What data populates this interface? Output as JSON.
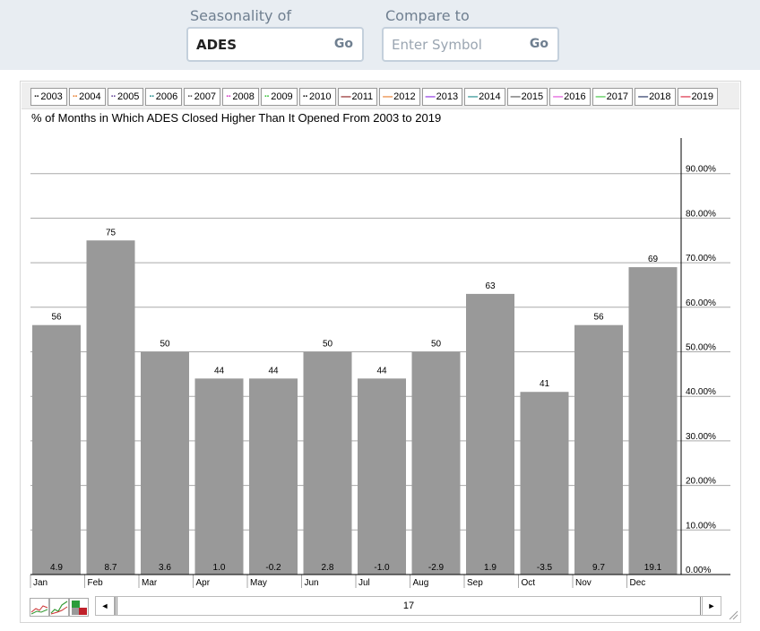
{
  "form": {
    "seasonality_label": "Seasonality of",
    "seasonality_value": "ADES",
    "compare_label": "Compare to",
    "compare_placeholder": "Enter Symbol",
    "go_label": "Go"
  },
  "legend": [
    {
      "year": "2003",
      "color": "#222222",
      "dash": "··"
    },
    {
      "year": "2004",
      "color": "#e87d2b",
      "dash": "··"
    },
    {
      "year": "2005",
      "color": "#6a4c9c",
      "dash": "··"
    },
    {
      "year": "2006",
      "color": "#1d8a8a",
      "dash": "··"
    },
    {
      "year": "2007",
      "color": "#555555",
      "dash": "··"
    },
    {
      "year": "2008",
      "color": "#d23bc4",
      "dash": "··"
    },
    {
      "year": "2009",
      "color": "#3cc43c",
      "dash": "··"
    },
    {
      "year": "2010",
      "color": "#111111",
      "dash": "··"
    },
    {
      "year": "2011",
      "color": "#8b1a1a",
      "dash": "—"
    },
    {
      "year": "2012",
      "color": "#e87d2b",
      "dash": "—"
    },
    {
      "year": "2013",
      "color": "#8a2be2",
      "dash": "—"
    },
    {
      "year": "2014",
      "color": "#1d8a8a",
      "dash": "—"
    },
    {
      "year": "2015",
      "color": "#555555",
      "dash": "—"
    },
    {
      "year": "2016",
      "color": "#e04ad9",
      "dash": "—"
    },
    {
      "year": "2017",
      "color": "#3cc43c",
      "dash": "—"
    },
    {
      "year": "2018",
      "color": "#1a2a5a",
      "dash": "—"
    },
    {
      "year": "2019",
      "color": "#d8203a",
      "dash": "—"
    }
  ],
  "chart_data": {
    "type": "bar",
    "title": "% of Months in Which ADES Closed Higher Than It Opened From 2003 to 2019",
    "categories": [
      "Jan",
      "Feb",
      "Mar",
      "Apr",
      "May",
      "Jun",
      "Jul",
      "Aug",
      "Sep",
      "Oct",
      "Nov",
      "Dec"
    ],
    "values": [
      56,
      75,
      50,
      44,
      44,
      50,
      44,
      50,
      63,
      41,
      56,
      69
    ],
    "avg_return": [
      "4.9",
      "8.7",
      "3.6",
      "1.0",
      "-0.2",
      "2.8",
      "-1.0",
      "-2.9",
      "1.9",
      "-3.5",
      "9.7",
      "19.1"
    ],
    "yticks": [
      "0.00%",
      "10.00%",
      "20.00%",
      "30.00%",
      "40.00%",
      "50.00%",
      "60.00%",
      "70.00%",
      "80.00%",
      "90.00%"
    ],
    "ylim": [
      0,
      100
    ],
    "bar_color": "#999999",
    "grid": true,
    "yaxis_side": "right"
  },
  "scroll": {
    "value": "17",
    "left_arrow": "◄",
    "right_arrow": "►"
  }
}
